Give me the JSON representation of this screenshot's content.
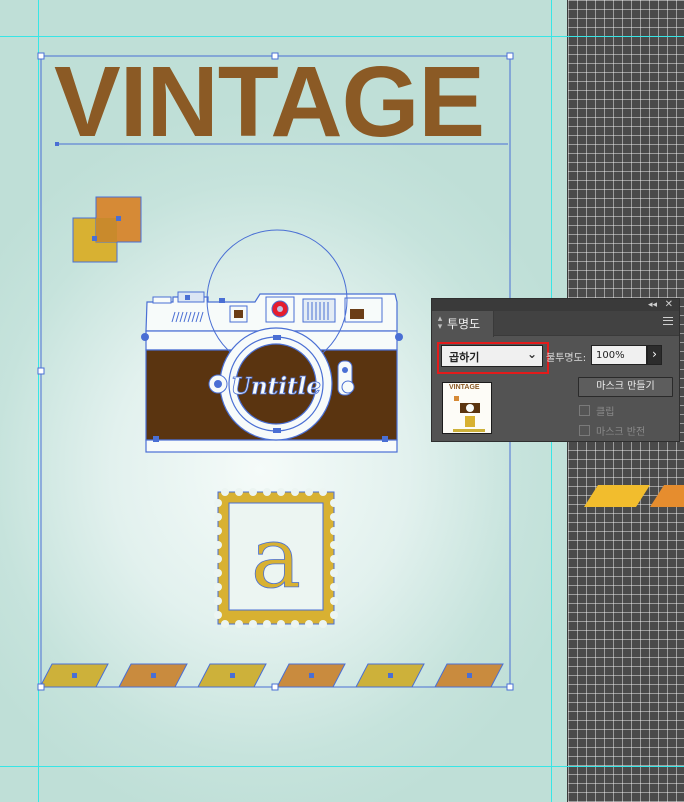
{
  "document": {
    "headline": "VINTAGE",
    "stamp_letter": "a",
    "camera_logo": "Untitle"
  },
  "colors": {
    "headline_brown": "#8b5a25",
    "camera_brown": "#5a3410",
    "mustard": "#d8b132",
    "orange": "#d68a36",
    "selection_blue": "#4a6fd4",
    "guide_cyan": "#37e6e6",
    "panel_bg": "#535353",
    "highlight_red": "#e31b1b"
  },
  "transparency_panel": {
    "tab_label": "투명도",
    "tab_icon": "up-down-arrows-icon",
    "collapse_icon": "double-chevron-icon",
    "close_icon": "close-icon",
    "menu_icon": "hamburger-menu-icon",
    "blend_mode": "곱하기",
    "opacity_label": "불투명도:",
    "opacity_value": "100%",
    "opacity_arrow": "›",
    "make_mask_label": "마스크 만들기",
    "clip_label": "클립",
    "invert_mask_label": "마스크 반전",
    "thumbnail_title": "VINTAGE"
  }
}
